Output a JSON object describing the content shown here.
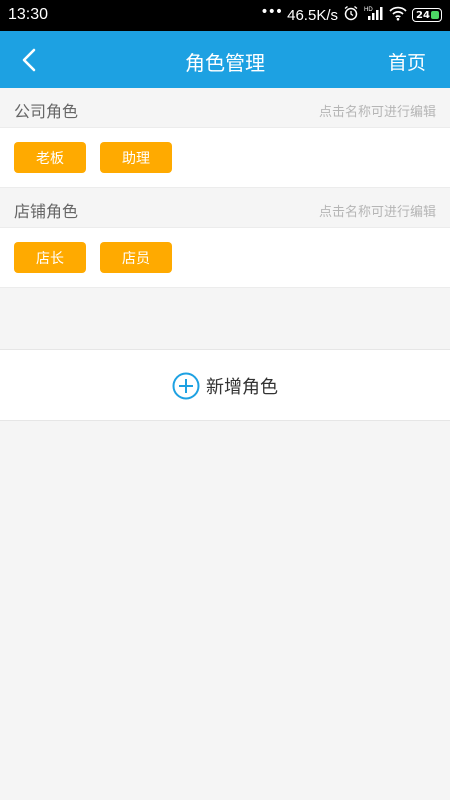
{
  "status": {
    "time": "13:30",
    "dots": "•••",
    "speed": "46.5K/s",
    "battery": "24"
  },
  "header": {
    "title": "角色管理",
    "home_label": "首页"
  },
  "sections": [
    {
      "title": "公司角色",
      "hint": "点击名称可进行编辑",
      "roles": [
        "老板",
        "助理"
      ]
    },
    {
      "title": "店铺角色",
      "hint": "点击名称可进行编辑",
      "roles": [
        "店长",
        "店员"
      ]
    }
  ],
  "add": {
    "label": "新增角色"
  },
  "colors": {
    "accent": "#1da1e2",
    "tag": "#ffaa00",
    "background": "#f5f5f5"
  }
}
